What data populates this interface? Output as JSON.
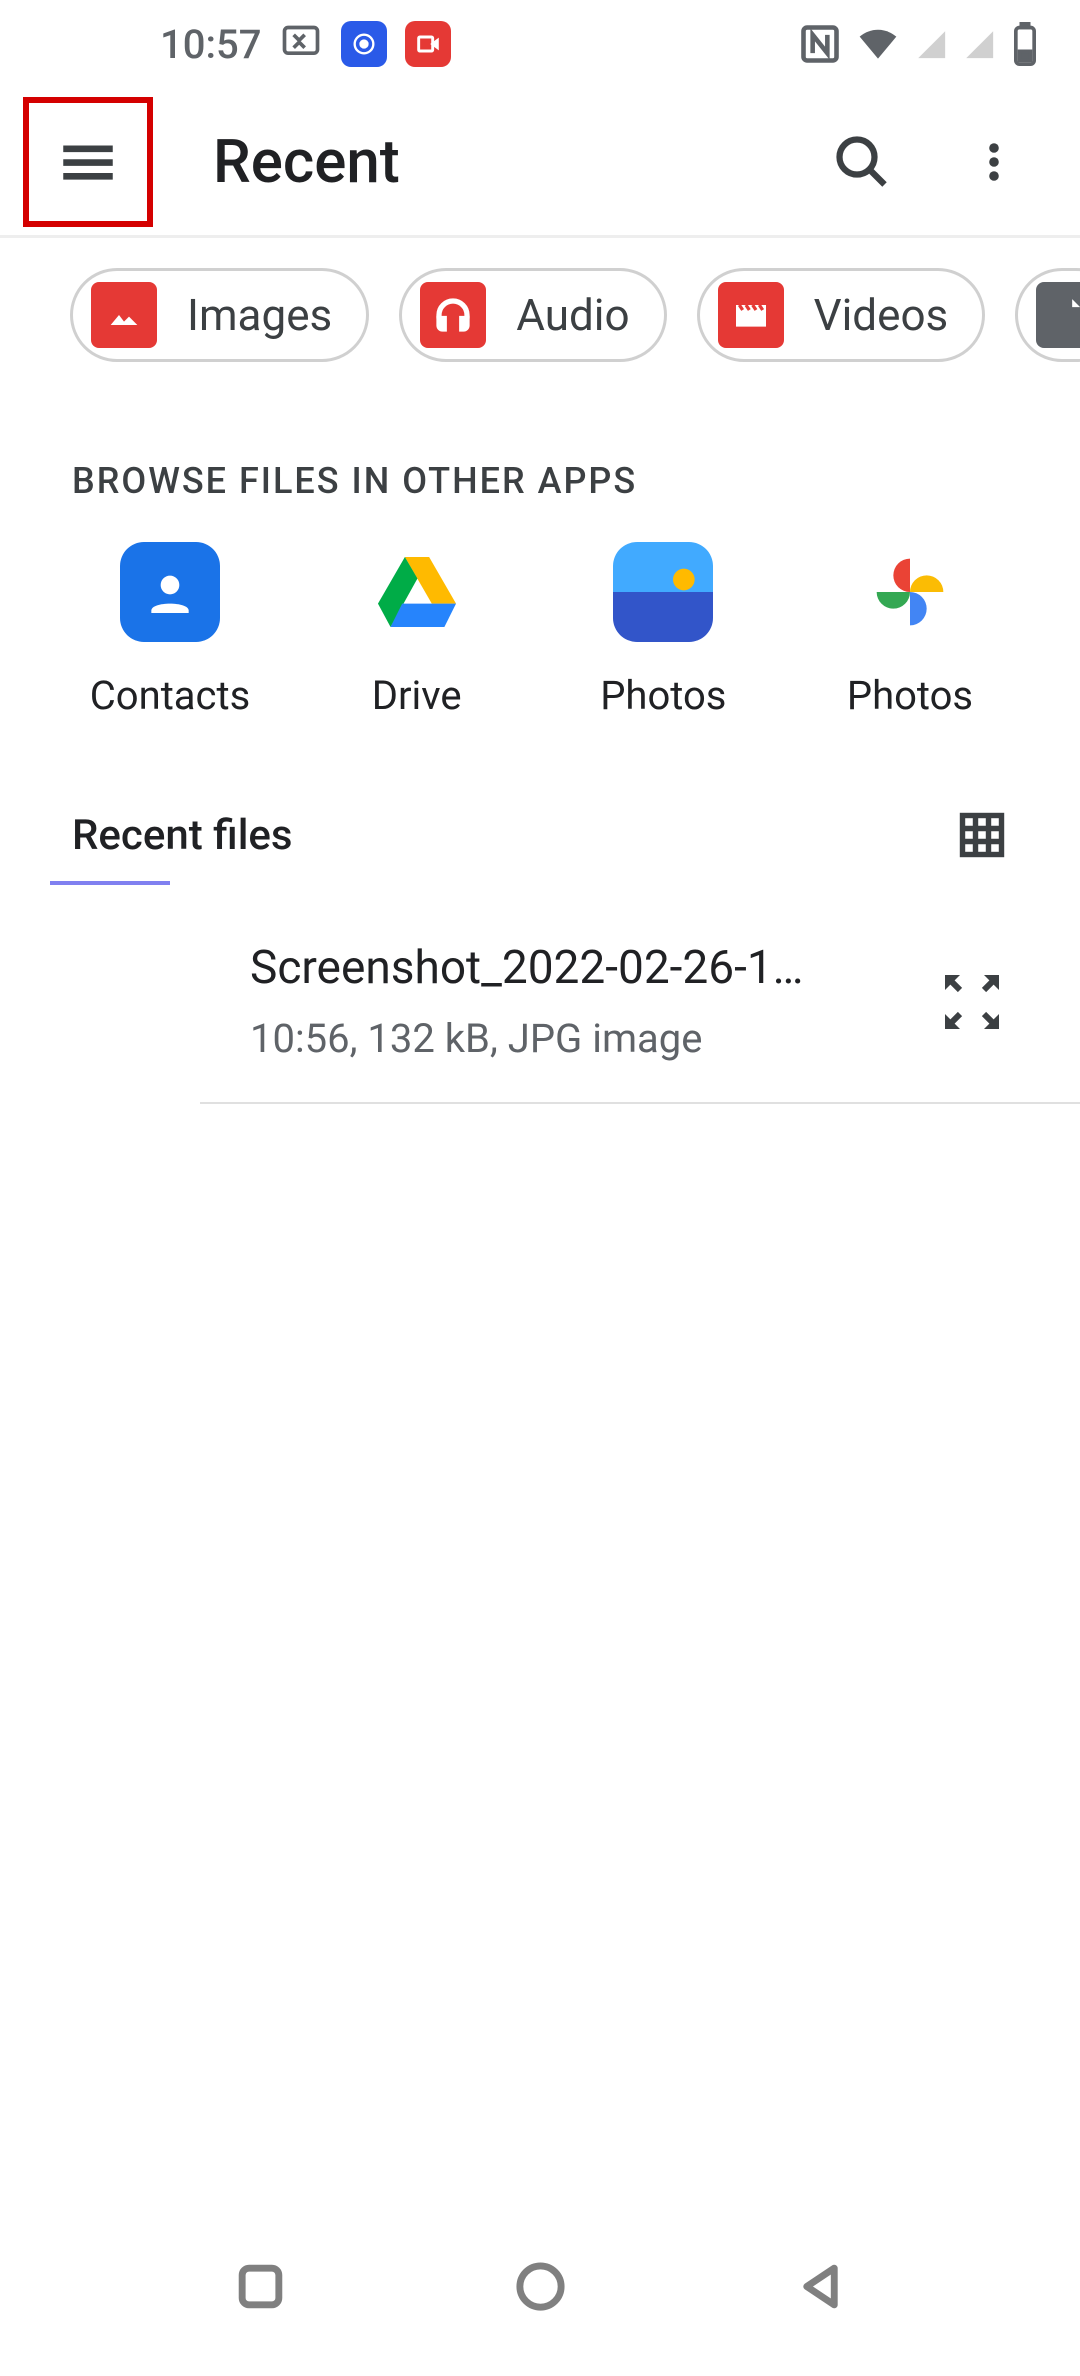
{
  "status_bar": {
    "time": "10:57"
  },
  "toolbar": {
    "title": "Recent"
  },
  "chips": [
    {
      "label": "Images",
      "icon": "image-icon"
    },
    {
      "label": "Audio",
      "icon": "headphones-icon"
    },
    {
      "label": "Videos",
      "icon": "clapper-icon"
    },
    {
      "label": "",
      "icon": "document-icon"
    }
  ],
  "browse": {
    "header": "BROWSE FILES IN OTHER APPS",
    "apps": [
      {
        "label": "Contacts",
        "id": "contacts"
      },
      {
        "label": "Drive",
        "id": "drive"
      },
      {
        "label": "Photos",
        "id": "photos-blue"
      },
      {
        "label": "Photos",
        "id": "photos-pinwheel"
      }
    ]
  },
  "recent": {
    "header": "Recent files",
    "files": [
      {
        "name": "Screenshot_2022-02-26-1…",
        "meta": "10:56, 132 kB, JPG image"
      }
    ]
  }
}
